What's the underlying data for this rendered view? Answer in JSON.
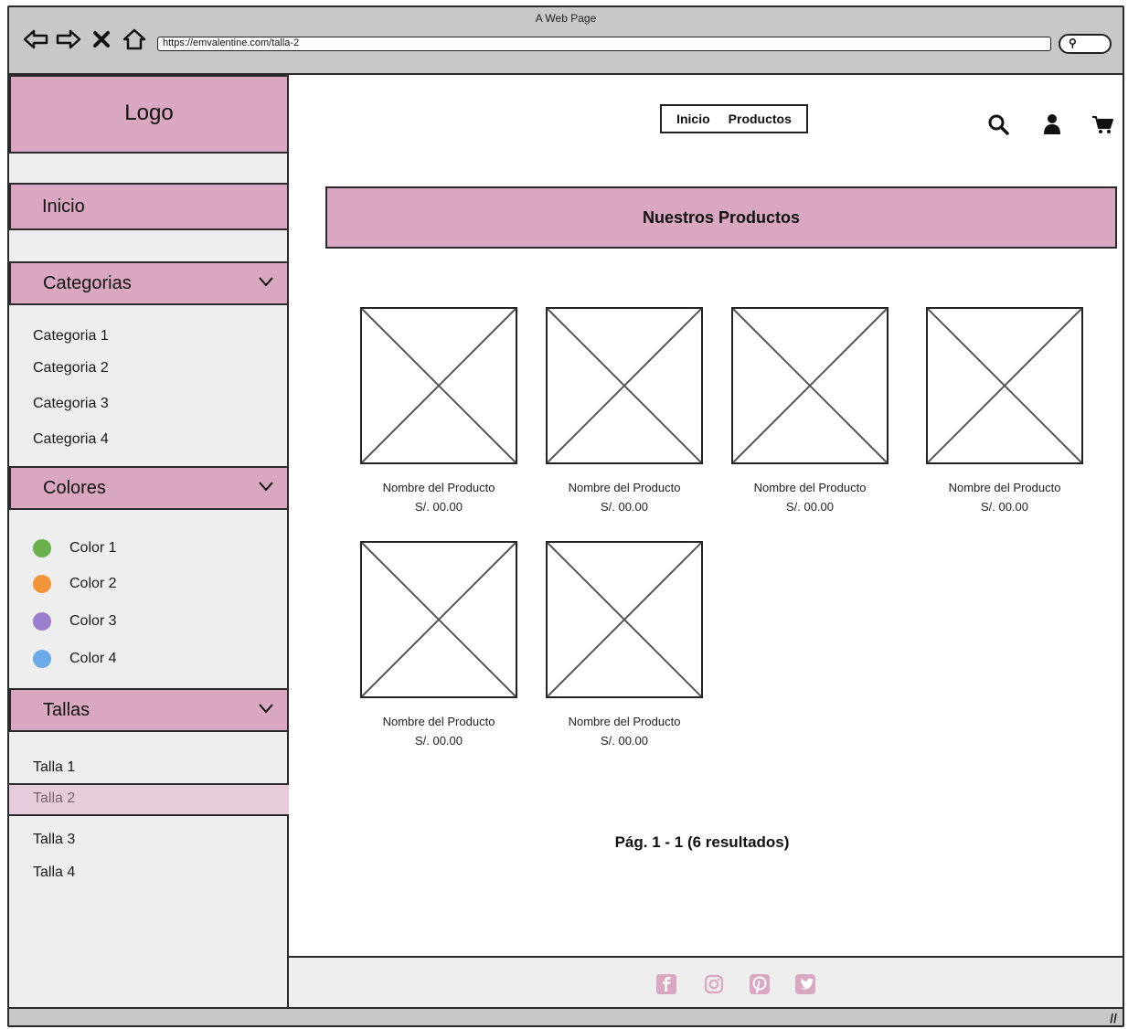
{
  "window": {
    "title": "A Web Page",
    "url": "https://emvalentine.com/talla-2"
  },
  "sidebar": {
    "logo": "Logo",
    "inicio": "Inicio",
    "categorias": {
      "title": "Categorias",
      "items": [
        "Categoria 1",
        "Categoria 2",
        "Categoria 3",
        "Categoria 4"
      ]
    },
    "colores": {
      "title": "Colores",
      "items": [
        {
          "label": "Color 1",
          "color": "#6ab04c"
        },
        {
          "label": "Color 2",
          "color": "#f0953a"
        },
        {
          "label": "Color 3",
          "color": "#9b7fcc"
        },
        {
          "label": "Color 4",
          "color": "#6cabe8"
        }
      ]
    },
    "tallas": {
      "title": "Tallas",
      "items": [
        "Talla 1",
        "Talla 2",
        "Talla 3",
        "Talla 4"
      ],
      "selected": "Talla 2"
    }
  },
  "header": {
    "nav": [
      "Inicio",
      "Productos"
    ],
    "icons": [
      "search-icon",
      "user-icon",
      "cart-icon"
    ]
  },
  "main": {
    "banner": "Nuestros Productos",
    "products": [
      {
        "name": "Nombre del Producto",
        "price": "S/. 00.00"
      },
      {
        "name": "Nombre del Producto",
        "price": "S/. 00.00"
      },
      {
        "name": "Nombre del Producto",
        "price": "S/. 00.00"
      },
      {
        "name": "Nombre del Producto",
        "price": "S/. 00.00"
      },
      {
        "name": "Nombre del Producto",
        "price": "S/. 00.00"
      },
      {
        "name": "Nombre del Producto",
        "price": "S/. 00.00"
      }
    ],
    "pagination": "Pág. 1 - 1 (6 resultados)"
  },
  "footer": {
    "social_icons": [
      "facebook-icon",
      "instagram-icon",
      "pinterest-icon",
      "twitter-icon"
    ],
    "icon_color": "#d9a7c0"
  },
  "theme": {
    "accent": "#d9a7c0",
    "accent_light": "#e6ccda",
    "sidebar_bg": "#eeeeee",
    "chrome_bg": "#c8c8c8"
  }
}
